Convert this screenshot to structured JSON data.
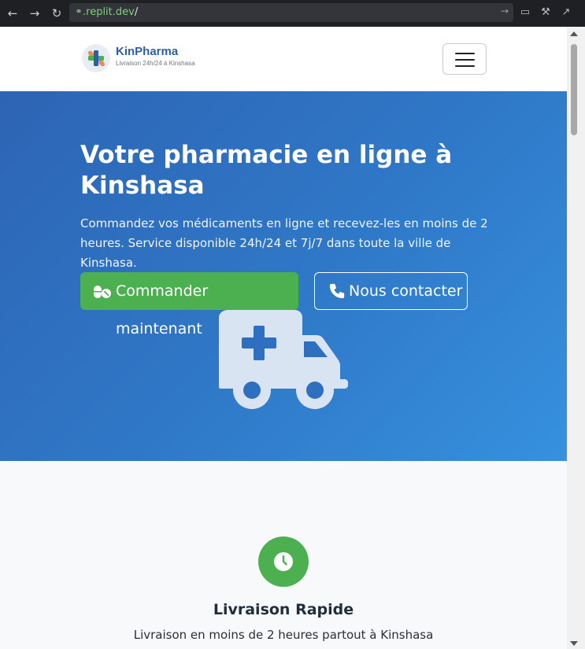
{
  "browser": {
    "url_host": ".replit.dev",
    "url_path": "/"
  },
  "header": {
    "brand_name": "KinPharma",
    "brand_tagline": "Livraison 24h/24 à Kinshasa"
  },
  "hero": {
    "title": "Votre pharmacie en ligne à Kinshasa",
    "subtitle": "Commandez vos médicaments en ligne et recevez-les en moins de 2 heures. Service disponible 24h/24 et 7j/7 dans toute la ville de Kinshasa.",
    "primary_button": "Commander maintenant",
    "secondary_button": "Nous contacter"
  },
  "features": [
    {
      "icon": "clock-icon",
      "title": "Livraison Rapide",
      "text": "Livraison en moins de 2 heures partout à Kinshasa"
    }
  ],
  "colors": {
    "brand_blue": "#2b5fa8",
    "accent_green": "#4caf50",
    "hero_gradient_start": "#2e64b4",
    "hero_gradient_end": "#3691de"
  }
}
